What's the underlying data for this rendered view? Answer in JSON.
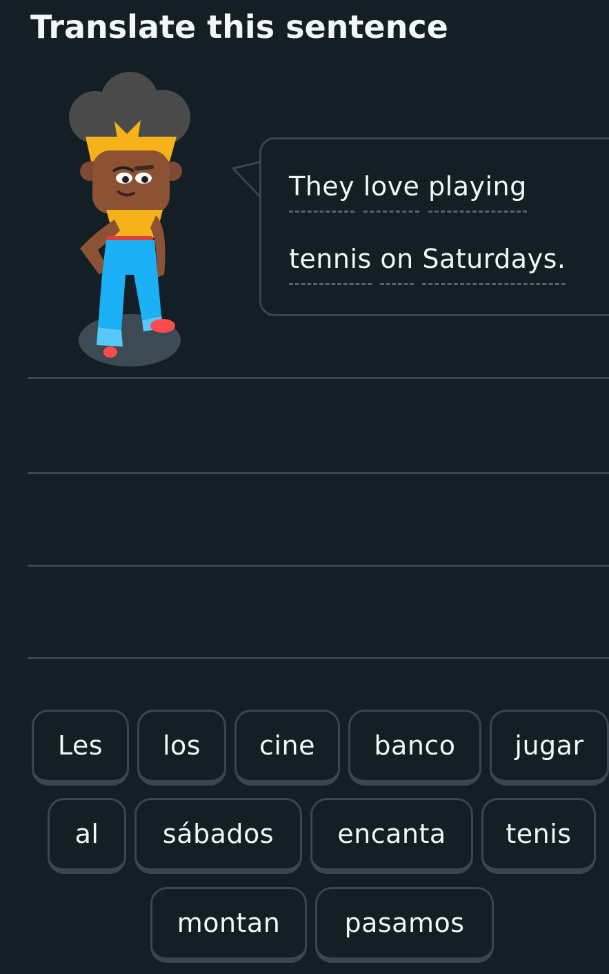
{
  "header": {
    "title": "Translate this sentence"
  },
  "prompt": {
    "line1": [
      "They",
      "love",
      "playing"
    ],
    "line2": [
      "tennis",
      "on",
      "Saturdays."
    ]
  },
  "word_bank": [
    "Les",
    "los",
    "cine",
    "banco",
    "jugar",
    "al",
    "sábados",
    "encanta",
    "tenis",
    "montan",
    "pasamos"
  ],
  "colors": {
    "background": "#131f24",
    "text": "#f1f7fb",
    "border": "#37464f",
    "hint_underline": "#52656d"
  }
}
